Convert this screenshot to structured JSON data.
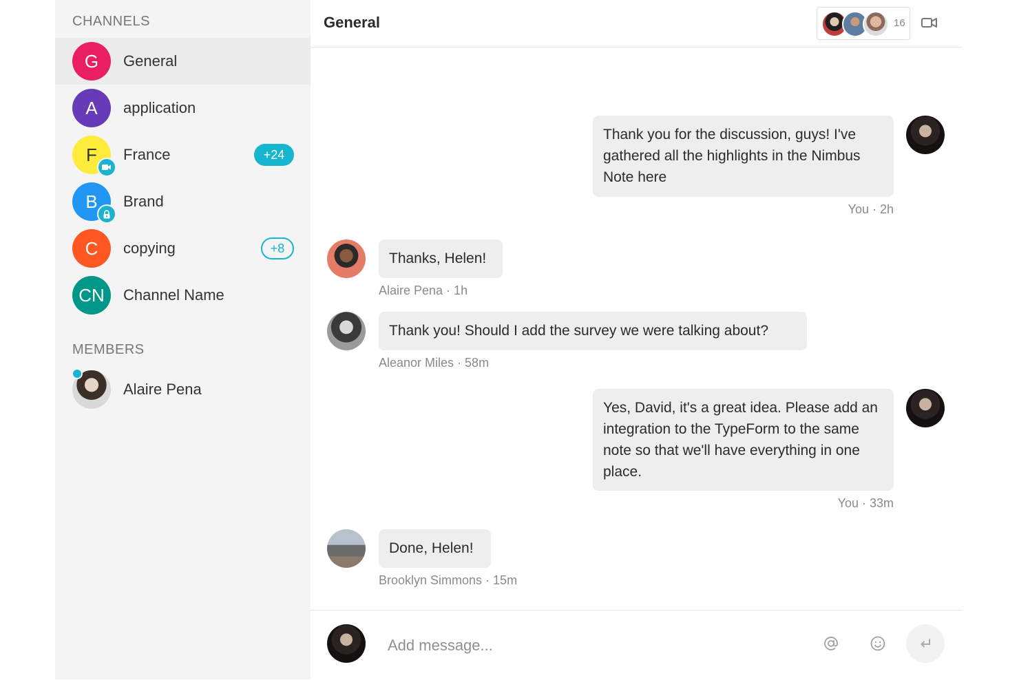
{
  "sidebar": {
    "channels_title": "CHANNELS",
    "members_title": "MEMBERS",
    "channels": [
      {
        "initial": "G",
        "label": "General",
        "color": "#e91e63",
        "active": true
      },
      {
        "initial": "A",
        "label": "application",
        "color": "#673ab7"
      },
      {
        "initial": "F",
        "label": "France",
        "color": "#ffeb3b",
        "badge": "+24",
        "sub_icon": "video-icon"
      },
      {
        "initial": "B",
        "label": "Brand",
        "color": "#2196f3",
        "sub_icon": "lock-icon"
      },
      {
        "initial": "C",
        "label": "copying",
        "color": "#ff5722",
        "badge": "+8"
      },
      {
        "initial": "CN",
        "label": "Channel Name",
        "color": "#009688"
      }
    ],
    "members": [
      {
        "name": "Alaire Pena",
        "online": true
      }
    ]
  },
  "header": {
    "title": "General",
    "participant_count": "16"
  },
  "messages": [
    {
      "text": "Thank you for the discussion, guys! I've gathered all the highlights in the Nimbus Note here",
      "meta": "You · 2h",
      "own": true
    },
    {
      "text": "Thanks, Helen!",
      "meta": "Alaire Pena · 1h",
      "own": false
    },
    {
      "text": "Thank you! Should I add the survey we were talking about?",
      "meta": "Aleanor Miles · 58m",
      "own": false
    },
    {
      "text": "Yes, David, it's a great idea. Please add an integration to the TypeForm to the same note so that we'll have everything in one place.",
      "meta": "You · 33m",
      "own": true
    },
    {
      "text": "Done, Helen!",
      "meta": "Brooklyn Simmons · 15m",
      "own": false
    }
  ],
  "composer": {
    "placeholder": "Add message..."
  },
  "colors": {
    "accent": "#16b5d0",
    "sidebar_bg": "#f4f4f4",
    "bubble_bg": "#eeeeee"
  }
}
